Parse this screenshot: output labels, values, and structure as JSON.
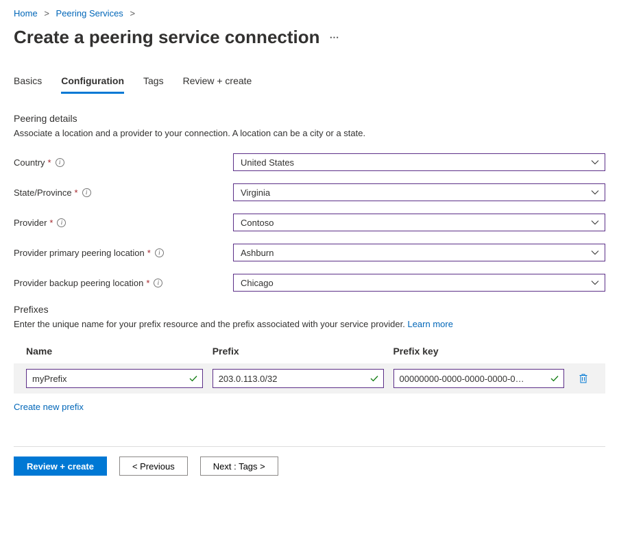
{
  "breadcrumb": {
    "items": [
      "Home",
      "Peering Services"
    ]
  },
  "page_title": "Create a peering service connection",
  "tabs": [
    "Basics",
    "Configuration",
    "Tags",
    "Review + create"
  ],
  "active_tab_index": 1,
  "peering_details": {
    "heading": "Peering details",
    "desc": "Associate a location and a provider to your connection. A location can be a city or a state.",
    "fields": {
      "country": {
        "label": "Country",
        "value": "United States"
      },
      "state": {
        "label": "State/Province",
        "value": "Virginia"
      },
      "provider": {
        "label": "Provider",
        "value": "Contoso"
      },
      "primary_loc": {
        "label": "Provider primary peering location",
        "value": "Ashburn"
      },
      "backup_loc": {
        "label": "Provider backup peering location",
        "value": "Chicago"
      }
    }
  },
  "prefixes": {
    "heading": "Prefixes",
    "desc": "Enter the unique name for your prefix resource and the prefix associated with your service provider. ",
    "learn_more": "Learn more",
    "columns": {
      "name": "Name",
      "prefix": "Prefix",
      "key": "Prefix key"
    },
    "row": {
      "name": "myPrefix",
      "prefix": "203.0.113.0/32",
      "key": "00000000-0000-0000-0000-0…"
    },
    "create_link": "Create new prefix"
  },
  "footer": {
    "review": "Review + create",
    "previous": "< Previous",
    "next": "Next : Tags >"
  }
}
